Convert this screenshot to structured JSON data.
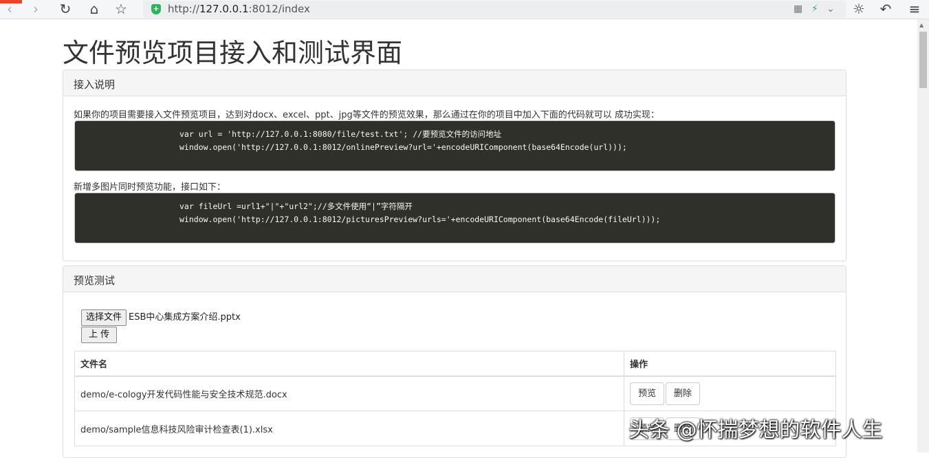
{
  "browser": {
    "url_prefix": "http://",
    "url_host": "127.0.0.1",
    "url_rest": ":8012/index",
    "icons": [
      "back-icon",
      "forward-icon",
      "reload-icon",
      "home-icon",
      "star-icon",
      "qr-icon",
      "bolt-icon",
      "chevron-down-icon",
      "brightness-icon",
      "undo-icon",
      "menu-icon"
    ]
  },
  "page": {
    "title": "文件预览项目接入和测试界面"
  },
  "integration": {
    "header": "接入说明",
    "desc1": "如果你的项目需要接入文件预览项目，达到对docx、excel、ppt、jpg等文件的预览效果，那么通过在你的项目中加入下面的代码就可以 成功实现：",
    "code1_line1": "var url = 'http://127.0.0.1:8080/file/test.txt'; //要预览文件的访问地址",
    "code1_line2": "window.open('http://127.0.0.1:8012/onlinePreview?url='+encodeURIComponent(base64Encode(url)));",
    "desc2": "新增多图片同时预览功能，接口如下：",
    "code2_line1": "var fileUrl =url1+\"|\"+\"url2\";//多文件使用“|”字符隔开",
    "code2_line2": "window.open('http://127.0.0.1:8012/picturesPreview?urls='+encodeURIComponent(base64Encode(fileUrl)));"
  },
  "preview_test": {
    "header": "预览测试",
    "choose_file_label": "选择文件",
    "chosen_file": "ESB中心集成方案介绍.pptx",
    "upload_label": "上 传",
    "table": {
      "col_filename": "文件名",
      "col_action": "操作",
      "rows": [
        {
          "name": "demo/e-cology开发代码性能与安全技术规范.docx",
          "preview": "预览",
          "delete": "删除"
        },
        {
          "name": "demo/sample信息科技风险审计检查表(1).xlsx",
          "preview": "预览",
          "delete": "删除"
        }
      ]
    }
  },
  "watermark": "头条 @怀揣梦想的软件人生"
}
